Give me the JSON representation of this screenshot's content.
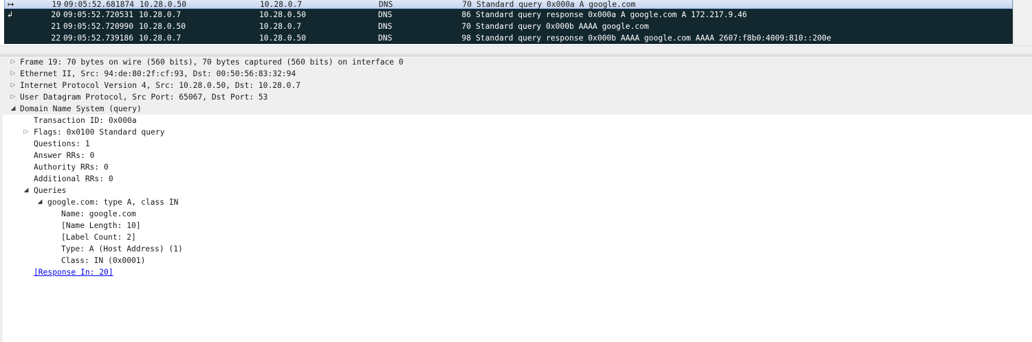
{
  "packet_list": {
    "rows": [
      {
        "no": "19",
        "time": "09:05:52.681874",
        "src": "10.28.0.50",
        "dst": "10.28.0.7",
        "proto": "DNS",
        "len": "70",
        "info": "Standard query 0x000a A google.com",
        "rel_icon": "↦"
      },
      {
        "no": "20",
        "time": "09:05:52.720531",
        "src": "10.28.0.7",
        "dst": "10.28.0.50",
        "proto": "DNS",
        "len": "86",
        "info": "Standard query response 0x000a A google.com A 172.217.9.46",
        "rel_icon": "↲"
      },
      {
        "no": "21",
        "time": "09:05:52.720990",
        "src": "10.28.0.50",
        "dst": "10.28.0.7",
        "proto": "DNS",
        "len": "70",
        "info": "Standard query 0x000b AAAA google.com",
        "rel_icon": ""
      },
      {
        "no": "22",
        "time": "09:05:52.739186",
        "src": "10.28.0.7",
        "dst": "10.28.0.50",
        "proto": "DNS",
        "len": "98",
        "info": "Standard query response 0x000b AAAA google.com AAAA 2607:f8b0:4009:810::200e",
        "rel_icon": ""
      }
    ],
    "selected_row": 0
  },
  "details": {
    "items": [
      {
        "text": "Frame 19: 70 bytes on wire (560 bits), 70 bytes captured (560 bits) on interface 0",
        "expander": "▷"
      },
      {
        "text": "Ethernet II, Src: 94:de:80:2f:cf:93, Dst: 00:50:56:83:32:94",
        "expander": "▷"
      },
      {
        "text": "Internet Protocol Version 4, Src: 10.28.0.50, Dst: 10.28.0.7",
        "expander": "▷"
      },
      {
        "text": "User Datagram Protocol, Src Port: 65067, Dst Port: 53",
        "expander": "▷"
      },
      {
        "text": "Domain Name System (query)",
        "expander": "◢"
      },
      {
        "text": "Transaction ID: 0x000a",
        "expander": ""
      },
      {
        "text": "Flags: 0x0100 Standard query",
        "expander": "▷"
      },
      {
        "text": "Questions: 1",
        "expander": ""
      },
      {
        "text": "Answer RRs: 0",
        "expander": ""
      },
      {
        "text": "Authority RRs: 0",
        "expander": ""
      },
      {
        "text": "Additional RRs: 0",
        "expander": ""
      },
      {
        "text": "Queries",
        "expander": "◢"
      },
      {
        "text": "google.com: type A, class IN",
        "expander": "◢"
      },
      {
        "text": "Name: google.com",
        "expander": ""
      },
      {
        "text": "[Name Length: 10]",
        "expander": ""
      },
      {
        "text": "[Label Count: 2]",
        "expander": ""
      },
      {
        "text": "Type: A (Host Address) (1)",
        "expander": ""
      },
      {
        "text": "Class: IN (0x0001)",
        "expander": ""
      },
      {
        "text": "[Response In: 20]",
        "expander": ""
      }
    ]
  },
  "colors": {
    "dns_row_bg": "#12272e",
    "selected_row_bg": "#c5d5ec",
    "link": "#0000ee"
  },
  "icons": {
    "expand_collapsed": "triangle-right-icon",
    "expand_open": "triangle-down-icon",
    "request_related": "related-request-icon",
    "response_related": "related-response-icon"
  }
}
